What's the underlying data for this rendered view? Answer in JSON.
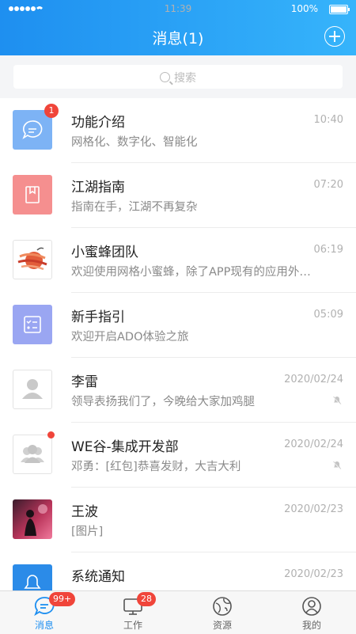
{
  "status_bar": {
    "time": "11:39",
    "battery": "100%"
  },
  "header": {
    "title": "消息(1)"
  },
  "search": {
    "placeholder": "搜索"
  },
  "messages": [
    {
      "name": "功能介绍",
      "subtitle": "网格化、数字化、智能化",
      "time": "10:40",
      "badge": "1",
      "avatar_icon": "chat-bubble-icon",
      "avatar_color": "#7db3f5"
    },
    {
      "name": "江湖指南",
      "subtitle": "指南在手，江湖不再复杂",
      "time": "07:20",
      "avatar_icon": "book-icon",
      "avatar_color": "#f58f8f"
    },
    {
      "name": "小蜜蜂团队",
      "subtitle": "欢迎使用网格小蜜蜂，除了APP现有的应用外…",
      "time": "06:19",
      "avatar_icon": "bee-team-logo"
    },
    {
      "name": "新手指引",
      "subtitle": "欢迎开启ADO体验之旅",
      "time": "05:09",
      "avatar_icon": "checklist-icon",
      "avatar_color": "#9aa6f2"
    },
    {
      "name": "李雷",
      "subtitle": "领导表扬我们了，今晚给大家加鸡腿",
      "time": "2020/02/24",
      "avatar_icon": "person-icon",
      "muted": true
    },
    {
      "name": "WE谷-集成开发部",
      "subtitle": "邓勇：[红包]恭喜发财，大吉大利",
      "time": "2020/02/24",
      "avatar_icon": "group-icon",
      "muted": true,
      "unread_dot": true
    },
    {
      "name": "王波",
      "subtitle": "[图片]",
      "time": "2020/02/23",
      "avatar_icon": "photo-avatar"
    },
    {
      "name": "系统通知",
      "subtitle": "",
      "time": "2020/02/23",
      "avatar_icon": "bell-icon",
      "avatar_color": "#2b8be8"
    }
  ],
  "tabs": [
    {
      "label": "消息",
      "icon": "message-icon",
      "badge": "99+",
      "active": true
    },
    {
      "label": "工作",
      "icon": "work-icon",
      "badge": "28"
    },
    {
      "label": "资源",
      "icon": "globe-icon"
    },
    {
      "label": "我的",
      "icon": "profile-icon"
    }
  ],
  "colors": {
    "primary": "#1e8ff0",
    "badge": "#f0453a"
  }
}
